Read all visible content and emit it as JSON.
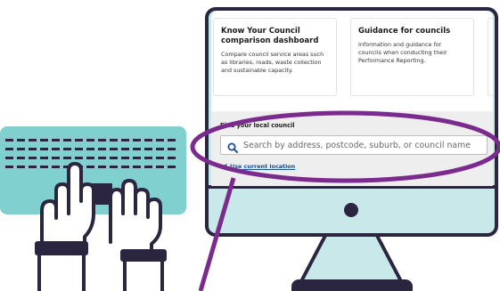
{
  "cards": [
    {
      "title": "Know Your Council comparison dashboard",
      "description": "Compare council service areas such as libraries, roads, waste collection and sustainable capacity."
    },
    {
      "title": "Guidance for councils",
      "description": "Information and guidance for councils when conducting their Performance Reporting."
    }
  ],
  "finder": {
    "label": "Find your local council",
    "search_placeholder": "Search by address, postcode, suburb, or council name",
    "location_link": "Use current location"
  },
  "colors": {
    "outline": "#2b2540",
    "keyboard": "#7fd0cf",
    "monitor_base": "#c9e8ea",
    "highlight": "#7b2a8e",
    "link": "#1d4e8f"
  },
  "icons": [
    "keyboard-illustration",
    "hands-illustration",
    "monitor-illustration",
    "search-icon",
    "location-arrow-icon"
  ]
}
